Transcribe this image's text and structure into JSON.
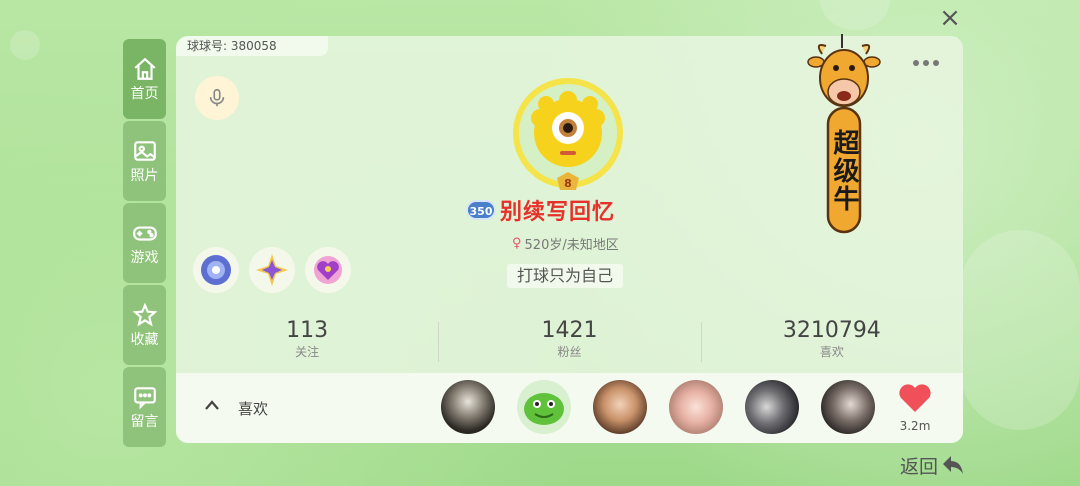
{
  "header": {
    "close_label": "×"
  },
  "sidebar": {
    "items": [
      {
        "label": "首页",
        "icon": "home-icon"
      },
      {
        "label": "照片",
        "icon": "photo-icon"
      },
      {
        "label": "游戏",
        "icon": "gamepad-icon"
      },
      {
        "label": "收藏",
        "icon": "star-icon"
      },
      {
        "label": "留言",
        "icon": "message-icon"
      }
    ]
  },
  "profile": {
    "id_label": "球球号: 380058",
    "level": "350",
    "avatar_rank": "8",
    "nickname": "别续写回忆",
    "meta": "520岁/未知地区",
    "signature": "打球只为自己"
  },
  "stats": [
    {
      "value": "113",
      "label": "关注"
    },
    {
      "value": "1421",
      "label": "粉丝"
    },
    {
      "value": "3210794",
      "label": "喜欢"
    }
  ],
  "likes_bar": {
    "label": "喜欢",
    "count": "3.2m"
  },
  "mascot": {
    "text": "超级牛"
  },
  "footer": {
    "back_label": "返回"
  },
  "colors": {
    "accent_green": "#8fc27a",
    "nickname_red": "#e8302a",
    "heart_red": "#f0505a"
  }
}
